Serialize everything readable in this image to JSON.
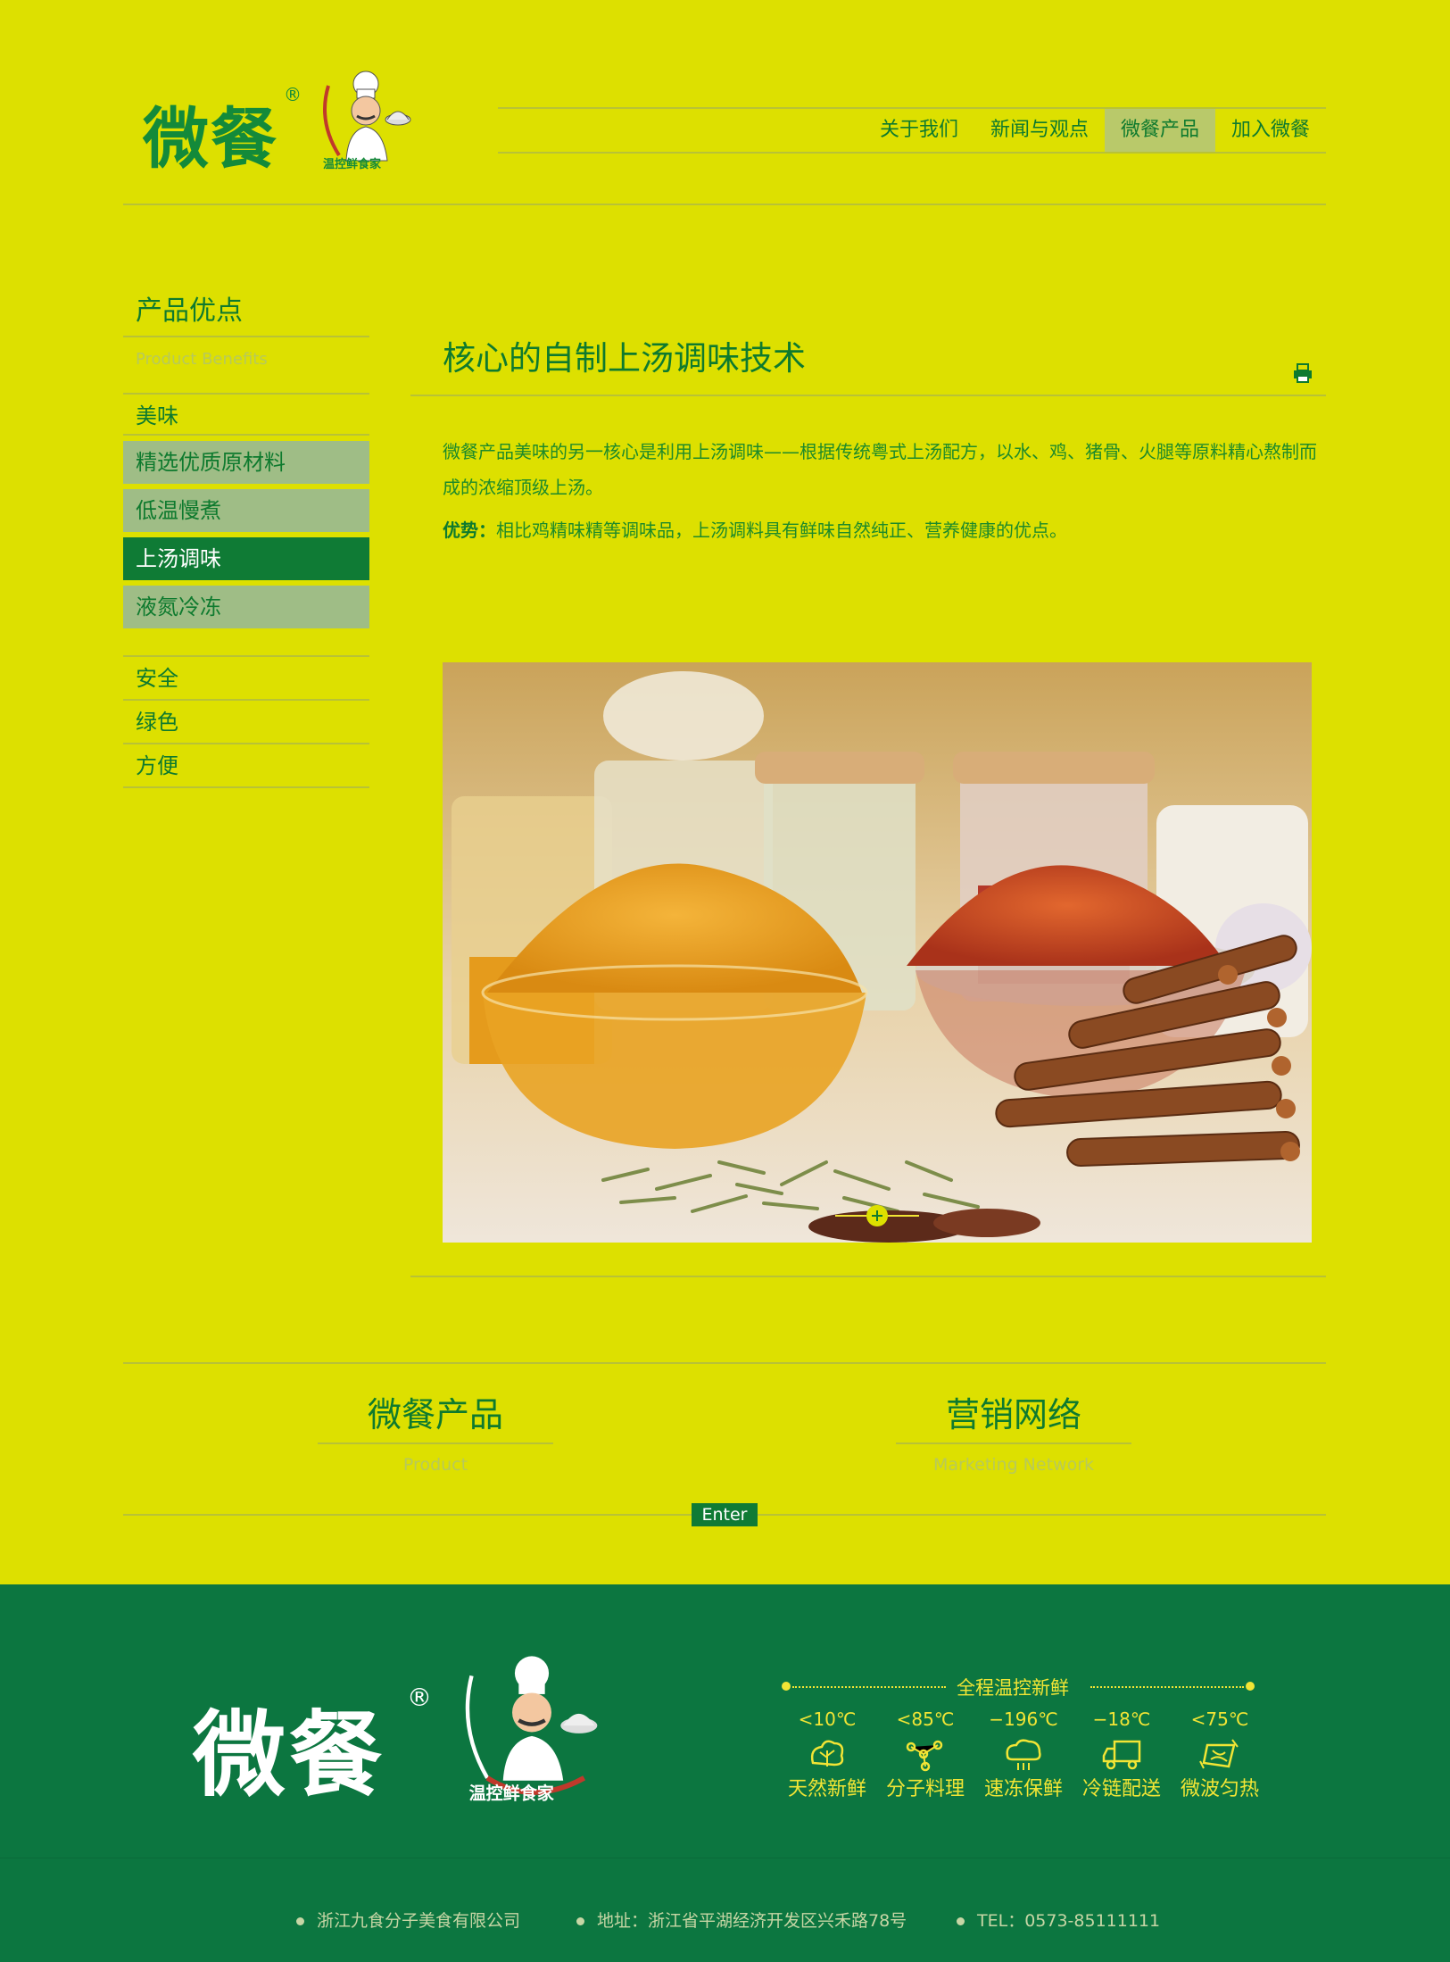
{
  "header": {
    "logo_text": "微餐",
    "logo_reg": "®",
    "nav": [
      {
        "label": "关于我们",
        "active": false
      },
      {
        "label": "新闻与观点",
        "active": false
      },
      {
        "label": "微餐产品",
        "active": true
      },
      {
        "label": "加入微餐",
        "active": false
      }
    ]
  },
  "sidebar": {
    "title": "产品优点",
    "subtitle": "Product Benefits",
    "items": [
      {
        "label": "美味"
      },
      {
        "label": "精选优质原材料"
      },
      {
        "label": "低温慢煮"
      },
      {
        "label": "上汤调味"
      },
      {
        "label": "液氮冷冻"
      }
    ],
    "links": [
      "安全",
      "绿色",
      "方便"
    ]
  },
  "content": {
    "title": "核心的自制上汤调味技术",
    "paragraph": "微餐产品美味的另一核心是利用上汤调味——根据传统粤式上汤配方，以水、鸡、猪骨、火腿等原料精心熬制而成的浓缩顶级上汤。",
    "advantage_label": "优势：",
    "advantage_text": "相比鸡精味精等调味品，上汤调料具有鲜味自然纯正、营养健康的优点。"
  },
  "bottom_nav": {
    "left_title": "微餐产品",
    "left_sub": "Product",
    "right_title": "营销网络",
    "right_sub": "Marketing Network",
    "enter_label": "Enter"
  },
  "footer": {
    "logo_text": "微餐",
    "logo_reg": "®",
    "features_title": "全程温控新鲜",
    "features": [
      {
        "temp": "<10℃",
        "label": "天然新鲜",
        "icon": "vegetable-icon"
      },
      {
        "temp": "<85℃",
        "label": "分子料理",
        "icon": "molecule-icon"
      },
      {
        "temp": "−196℃",
        "label": "速冻保鲜",
        "icon": "nitrogen-cloud-icon"
      },
      {
        "temp": "−18℃",
        "label": "冷链配送",
        "icon": "truck-icon"
      },
      {
        "temp": "<75℃",
        "label": "微波匀热",
        "icon": "microwave-icon"
      }
    ],
    "company": "浙江九食分子美食有限公司",
    "address": "地址：浙江省平湖经济开发区兴禾路78号",
    "tel": "TEL：0573-85111111"
  },
  "colors": {
    "background": "#dde000",
    "primary_green": "#0e7a2e",
    "footer_green": "#0c7640",
    "highlight_yellow": "#f2e535"
  }
}
